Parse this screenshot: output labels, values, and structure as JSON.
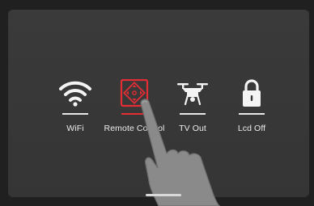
{
  "menu": {
    "items": [
      {
        "label": "WiFi",
        "icon": "wifi-icon",
        "active": false
      },
      {
        "label": "Remote Control",
        "icon": "remote-control-icon",
        "active": true
      },
      {
        "label": "TV Out",
        "icon": "drone-icon",
        "active": false
      },
      {
        "label": "Lcd Off",
        "icon": "lock-icon",
        "active": false
      }
    ]
  },
  "colors": {
    "background": "#353535",
    "active": "#e52d35",
    "text": "#ececec"
  }
}
